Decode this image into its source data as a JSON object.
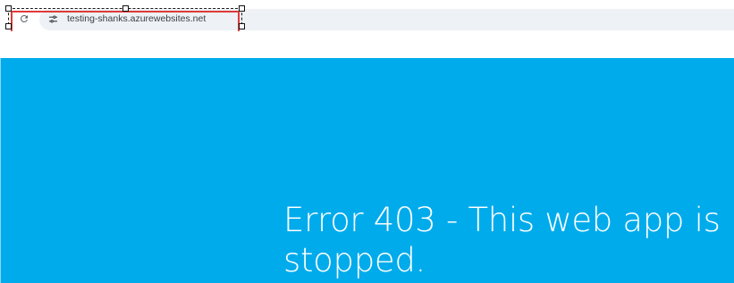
{
  "browser": {
    "reload_icon": "reload-icon",
    "site_info_icon": "tune-icon",
    "url": "testing-shanks.azurewebsites.net"
  },
  "error_page": {
    "heading": "Error 403 - This web app is stopped.",
    "background_color": "#00abec",
    "text_color": "#ffffff"
  },
  "annotation": {
    "selection_color": "#e03a3a"
  }
}
